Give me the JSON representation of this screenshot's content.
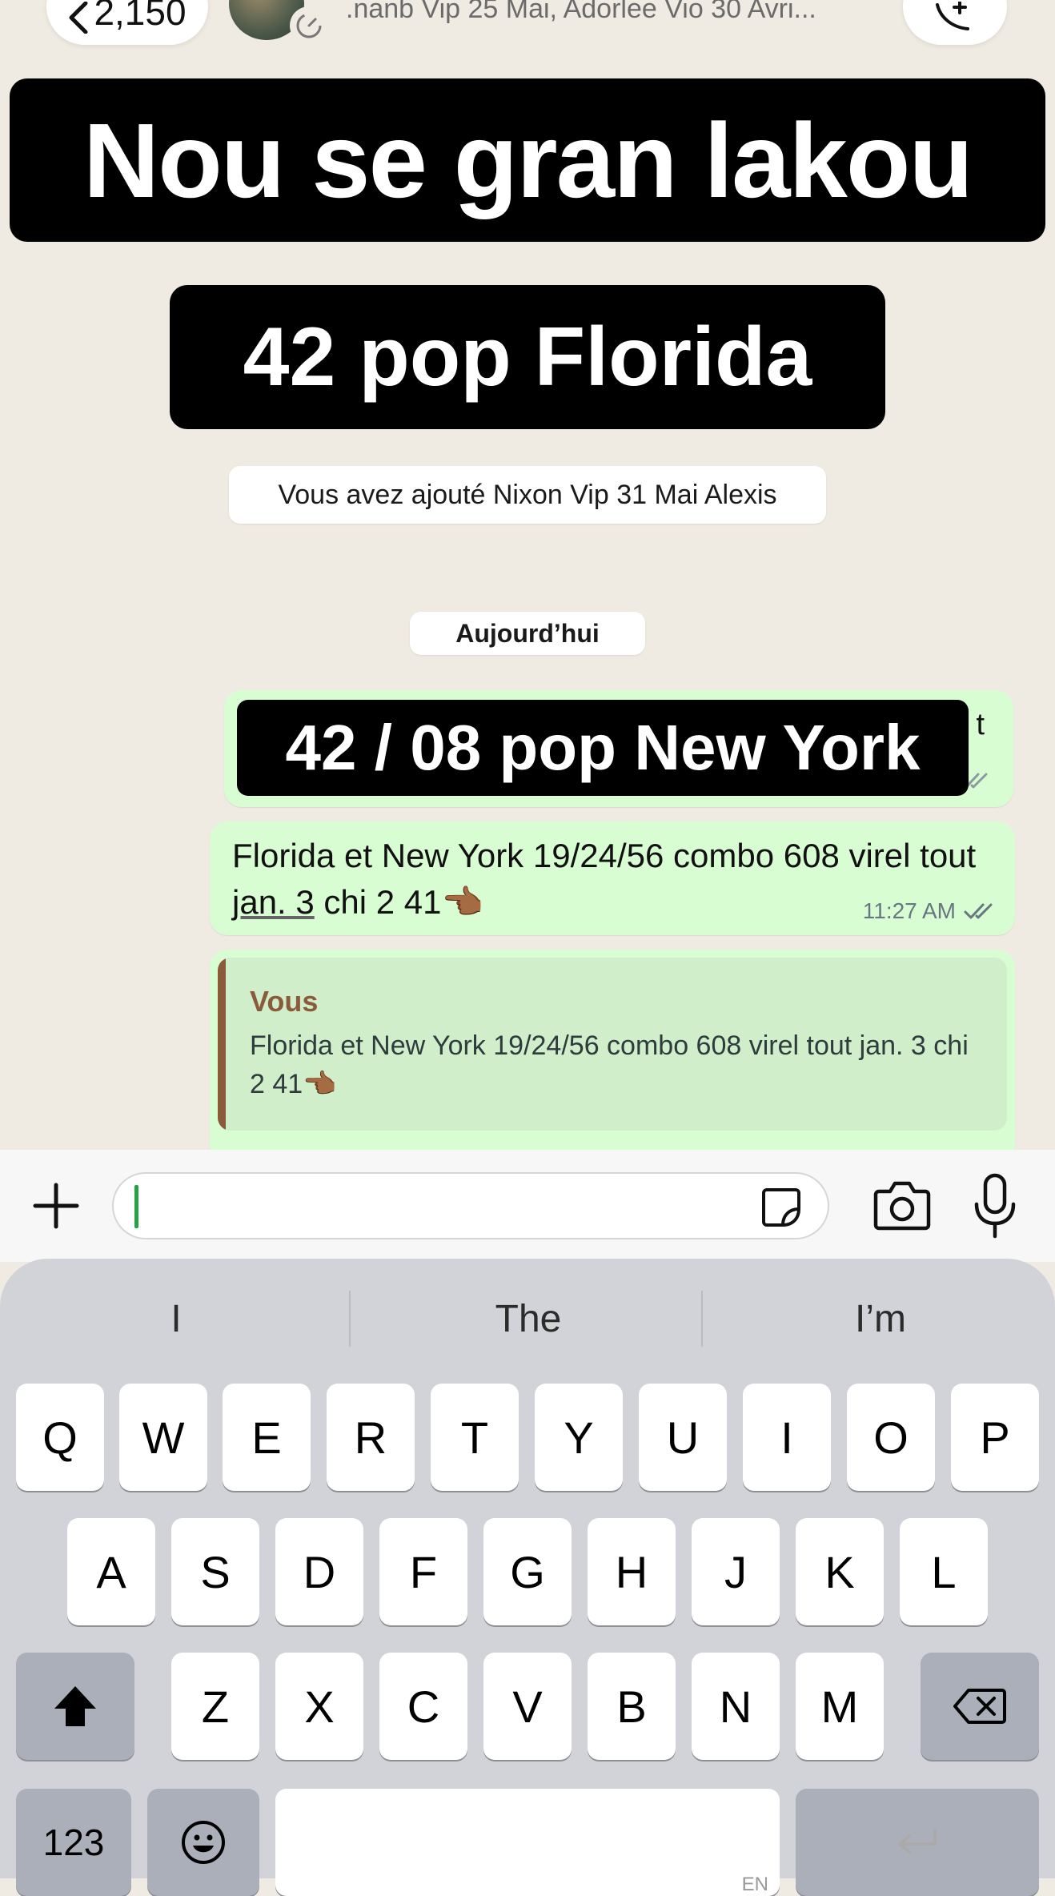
{
  "header": {
    "back_count": "2,150",
    "subtitle": ".nanb Vip 25 Mai, Adorlee Vio 30 Avri..."
  },
  "overlays": {
    "title": "Nou se gran lakou",
    "subtitle": "42 pop Florida",
    "bubble_caption": "42 / 08 pop New York"
  },
  "system_message": "Vous avez ajouté Nixon Vip 31 Mai Alexis",
  "date_separator": "Aujourd’hui",
  "messages": [
    {
      "partial_text": "t"
    },
    {
      "text_a": "Florida et New York 19/24/56 combo 608 virel tout ",
      "text_link": "jan. 3",
      "text_b": " chi 2 41👈🏾",
      "time": "11:27 AM"
    },
    {
      "quote_author": "Vous",
      "quote_text": "Florida et New York 19/24/56 combo 608 virel tout jan. 3 chi 2 41👈🏾"
    }
  ],
  "colors": {
    "outgoing_bubble": "#d9fdd3",
    "chat_background": "#efeae2",
    "quote_accent": "#8b5a3a",
    "caret": "#25a244"
  },
  "keyboard": {
    "suggestions": [
      "I",
      "The",
      "I’m"
    ],
    "row1": [
      "Q",
      "W",
      "E",
      "R",
      "T",
      "Y",
      "U",
      "I",
      "O",
      "P"
    ],
    "row2": [
      "A",
      "S",
      "D",
      "F",
      "G",
      "H",
      "J",
      "K",
      "L"
    ],
    "row3": [
      "Z",
      "X",
      "C",
      "V",
      "B",
      "N",
      "M"
    ],
    "numbers_key": "123",
    "space_lang": "EN"
  }
}
